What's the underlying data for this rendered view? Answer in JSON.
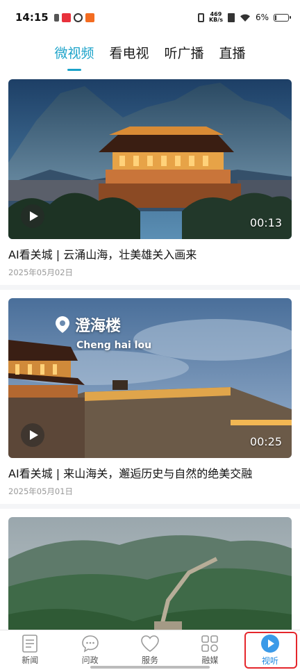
{
  "status_bar": {
    "time": "14:15",
    "net_speed_value": "469",
    "net_speed_unit": "KB/s",
    "battery": "6%"
  },
  "tabs": [
    {
      "label": "微视频",
      "active": true
    },
    {
      "label": "看电视",
      "active": false
    },
    {
      "label": "听广播",
      "active": false
    },
    {
      "label": "直播",
      "active": false
    }
  ],
  "videos": [
    {
      "title": "AI看关城 | 云涌山海，壮美雄关入画来",
      "date": "2025年05月02日",
      "duration": "00:13"
    },
    {
      "title": "AI看关城 | 来山海关，邂逅历史与自然的绝美交融",
      "date": "2025年05月01日",
      "duration": "00:25",
      "overlay_name": "澄海楼",
      "overlay_sub": "Cheng hai lou"
    },
    {
      "title": "",
      "date": "",
      "duration": ""
    }
  ],
  "bottom_nav": [
    {
      "label": "新闻",
      "icon": "news-icon"
    },
    {
      "label": "问政",
      "icon": "chat-icon"
    },
    {
      "label": "服务",
      "icon": "heart-icon"
    },
    {
      "label": "融媒",
      "icon": "grid-icon"
    },
    {
      "label": "视听",
      "icon": "play-circle-icon",
      "active": true
    }
  ],
  "colors": {
    "accent": "#1aa2c9",
    "nav_active": "#1a86e0",
    "highlight_box": "#e5262b"
  }
}
